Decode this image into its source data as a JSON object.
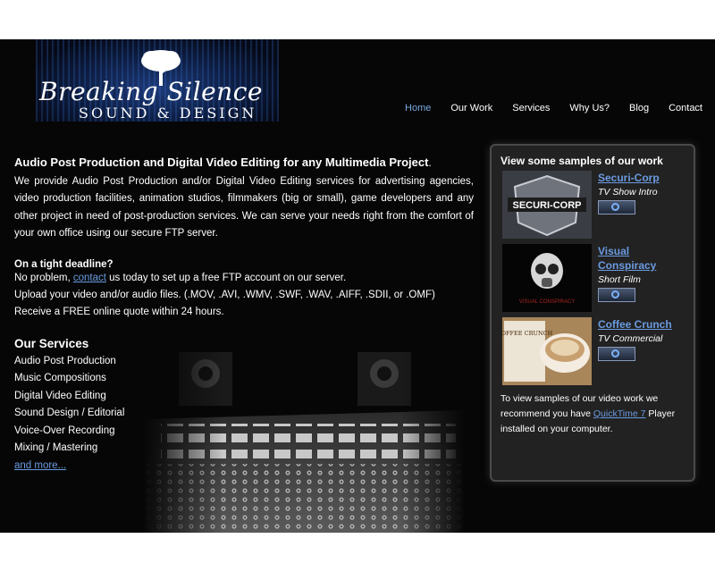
{
  "logo": {
    "line1": "Breaking Silence",
    "line2": "SOUND & DESIGN"
  },
  "nav": {
    "items": [
      "Home",
      "Our Work",
      "Services",
      "Why Us?",
      "Blog",
      "Contact"
    ],
    "active": "Home"
  },
  "intro": {
    "headline": "Audio Post Production and Digital Video Editing for any Multimedia Project",
    "headline_end": ".",
    "body": "We provide Audio Post Production and/or Digital Video Editing services for advertising agencies, video production facilities, animation studios, filmmakers (big or small), game developers and any other project in need of post-production services. We can serve your needs right from the comfort of your own office using our secure FTP server."
  },
  "deadline": {
    "heading": "On a tight deadline?",
    "line1_prefix": "No problem, ",
    "line1_link": "contact",
    "line1_suffix": " us today to set up a free FTP account on our server.",
    "line2": "Upload your video and/or audio files. (.MOV, .AVI, .WMV, .SWF, .WAV, .AIFF, .SDII, or .OMF)",
    "line3": "Receive a FREE online quote within 24 hours."
  },
  "services": {
    "heading": "Our Services",
    "items": [
      "Audio Post Production",
      "Music Compositions",
      "Digital Video Editing",
      "Sound Design / Editorial",
      "Voice-Over Recording",
      "Mixing / Mastering"
    ],
    "more": "and more..."
  },
  "sidebar": {
    "title": "View some samples of our work",
    "samples": [
      {
        "name": "Securi-Corp",
        "sub": "TV Show Intro",
        "thumb_text": "SECURI-CORP"
      },
      {
        "name": "Visual Conspiracy",
        "sub": "Short Film",
        "thumb_text": "VISUAL CONSPIRACY"
      },
      {
        "name": "Coffee Crunch",
        "sub": "TV Commercial",
        "thumb_text": "COFFEE CRUNCH"
      }
    ],
    "note_prefix": "To view samples of our video work we recommend you have ",
    "note_link": "QuickTime 7",
    "note_suffix": " Player installed on your computer."
  },
  "colors": {
    "background": "#060606",
    "link": "#6b9be0",
    "nav_active": "#7aa6e0",
    "panel": "#222222"
  }
}
